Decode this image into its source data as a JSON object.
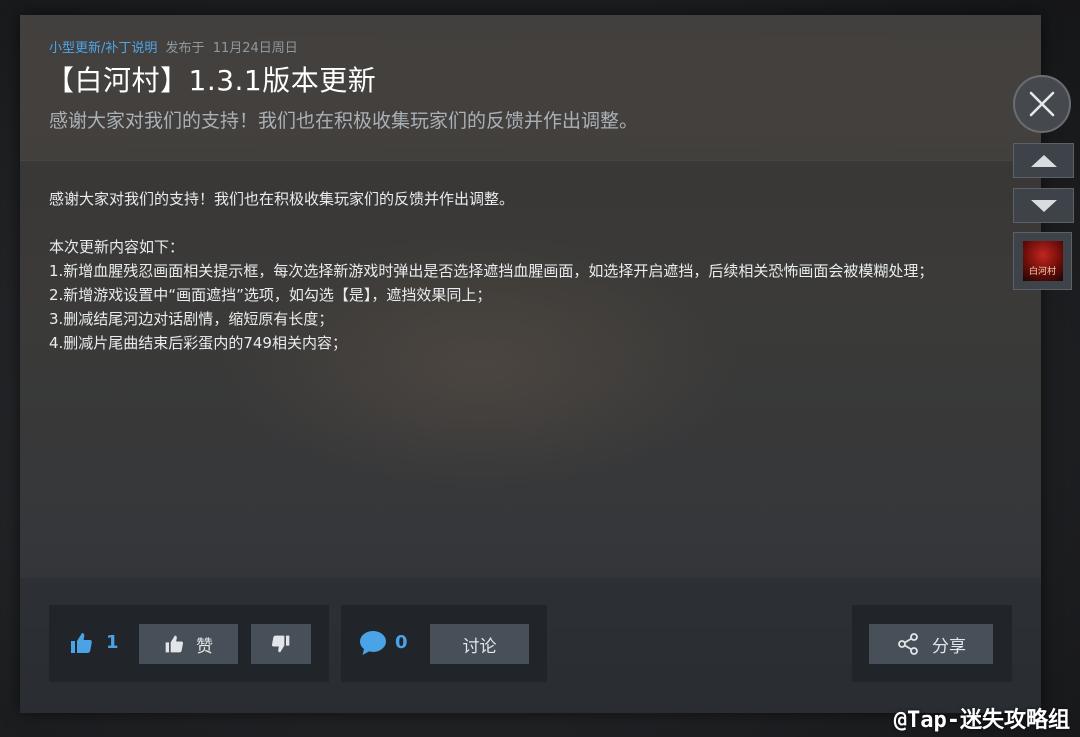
{
  "header": {
    "category": "小型更新/补丁说明",
    "posted_label": "发布于",
    "date": "11月24日周日",
    "title": "【白河村】1.3.1版本更新",
    "subtitle": "感谢大家对我们的支持！我们也在积极收集玩家们的反馈并作出调整。"
  },
  "body": {
    "intro": "感谢大家对我们的支持！我们也在积极收集玩家们的反馈并作出调整。",
    "list_heading": "本次更新内容如下：",
    "items": [
      "1.新增血腥残忍画面相关提示框，每次选择新游戏时弹出是否选择遮挡血腥画面，如选择开启遮挡，后续相关恐怖画面会被模糊处理；",
      "2.新增游戏设置中“画面遮挡”选项，如勾选【是】，遮挡效果同上；",
      "3.删减结尾河边对话剧情，缩短原有长度；",
      "4.删减片尾曲结束后彩蛋内的749相关内容；"
    ]
  },
  "footer": {
    "rating": {
      "like_count": "1",
      "like_label": "赞",
      "thumbs_up_icon": "thumbs-up-icon",
      "thumbs_down_icon": "thumbs-down-icon"
    },
    "comments": {
      "count": "0",
      "discuss_label": "讨论",
      "icon": "speech-bubble-icon"
    },
    "share": {
      "label": "分享",
      "icon": "share-icon"
    }
  },
  "side_nav": {
    "close_icon": "close-icon",
    "prev_icon": "arrow-up-icon",
    "next_icon": "arrow-down-icon",
    "thumbnail_text": "白河村"
  },
  "watermark": "@Tap-迷失攻略组",
  "colors": {
    "accent": "#4aa3e6",
    "category_link": "#4ea5e8",
    "button_bg": "#474f58",
    "panel_bg": "#1c2026"
  }
}
